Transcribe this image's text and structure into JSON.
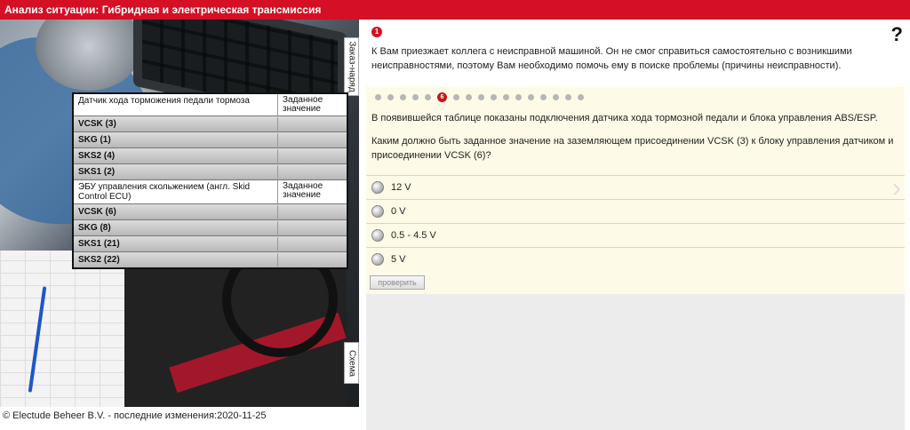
{
  "window": {
    "title": "Анализ ситуации: Гибридная и электрическая трансмиссия"
  },
  "side_tabs": {
    "order_tab": "Заказ-наряд",
    "schema_tab": "Схема"
  },
  "connection_table": {
    "sections": [
      {
        "header": "Датчик хода торможения педали тормоза",
        "value_header": "Заданное значение",
        "rows": [
          {
            "label": "VCSK (3)",
            "value": ""
          },
          {
            "label": "SKG (1)",
            "value": ""
          },
          {
            "label": "SKS2 (4)",
            "value": ""
          },
          {
            "label": "SKS1 (2)",
            "value": ""
          }
        ]
      },
      {
        "header": "ЭБУ управления скольжением (англ. Skid Control ECU)",
        "value_header": "Заданное значение",
        "rows": [
          {
            "label": "VCSK (6)",
            "value": ""
          },
          {
            "label": "SKG (8)",
            "value": ""
          },
          {
            "label": "SKS1 (21)",
            "value": ""
          },
          {
            "label": "SKS2 (22)",
            "value": ""
          }
        ]
      }
    ]
  },
  "footer": {
    "text": "© Electude Beheer B.V. - последние изменения:2020-11-25"
  },
  "task": {
    "step_number": "1",
    "intro": "К Вам приезжает коллега с неисправной машиной. Он не смог справиться самостоятельно с возникшими неисправностями, поэтому Вам необходимо помочь ему в поиске проблемы (причины неисправности).",
    "help_label": "?"
  },
  "question": {
    "current_step": "6",
    "total_dots": 17,
    "active_index": 5,
    "text1": "В появившейся таблице показаны подключения датчика хода тормозной педали и блока управления ABS/ESP.",
    "text2": "Каким должно быть заданное значение на заземляющем присоединении VCSK (3) к блоку управления датчиком и присоединении VCSK (6)?",
    "answers": [
      "12 V",
      "0 V",
      "0.5 - 4.5 V",
      "5 V"
    ],
    "check_label": "проверить",
    "prev_arrow": "‹",
    "next_arrow": "›"
  },
  "colors": {
    "brand_red": "#d50f24",
    "question_bg": "#fdfbe7",
    "dot_active": "#c6161b"
  }
}
